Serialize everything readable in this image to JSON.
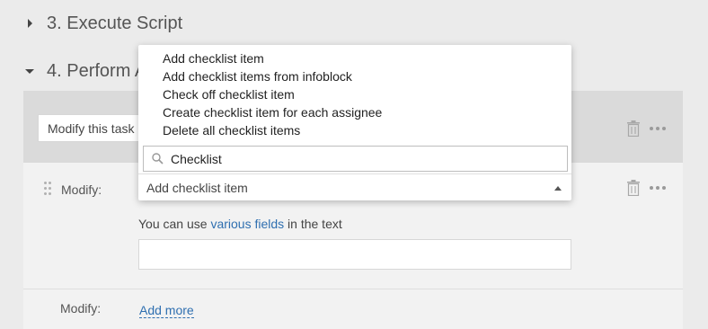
{
  "sections": [
    {
      "title": "3. Execute Script",
      "expanded": false
    },
    {
      "title": "4. Perform A",
      "expanded": true
    }
  ],
  "task_select": {
    "value": "Modify this task"
  },
  "rows": [
    {
      "label": "Modify:"
    },
    {
      "label": "Modify:"
    }
  ],
  "dropdown": {
    "options": [
      "Add checklist item",
      "Add checklist items from infoblock",
      "Check off checklist item",
      "Create checklist item for each assignee",
      "Delete all checklist items"
    ],
    "search_value": "Checklist",
    "selected": "Add checklist item"
  },
  "hint": {
    "prefix": "You can use ",
    "link": "various fields",
    "suffix": " in the text"
  },
  "add_more_label": "Add more",
  "icons": {
    "caret_collapsed": "caret-right-icon",
    "caret_expanded": "caret-down-icon",
    "trash": "trash-icon",
    "more": "more-dots-icon",
    "search": "search-icon",
    "drag": "drag-handle-icon"
  },
  "colors": {
    "link": "#2f6fb0",
    "background": "#ebebeb",
    "panel": "#dadada"
  }
}
